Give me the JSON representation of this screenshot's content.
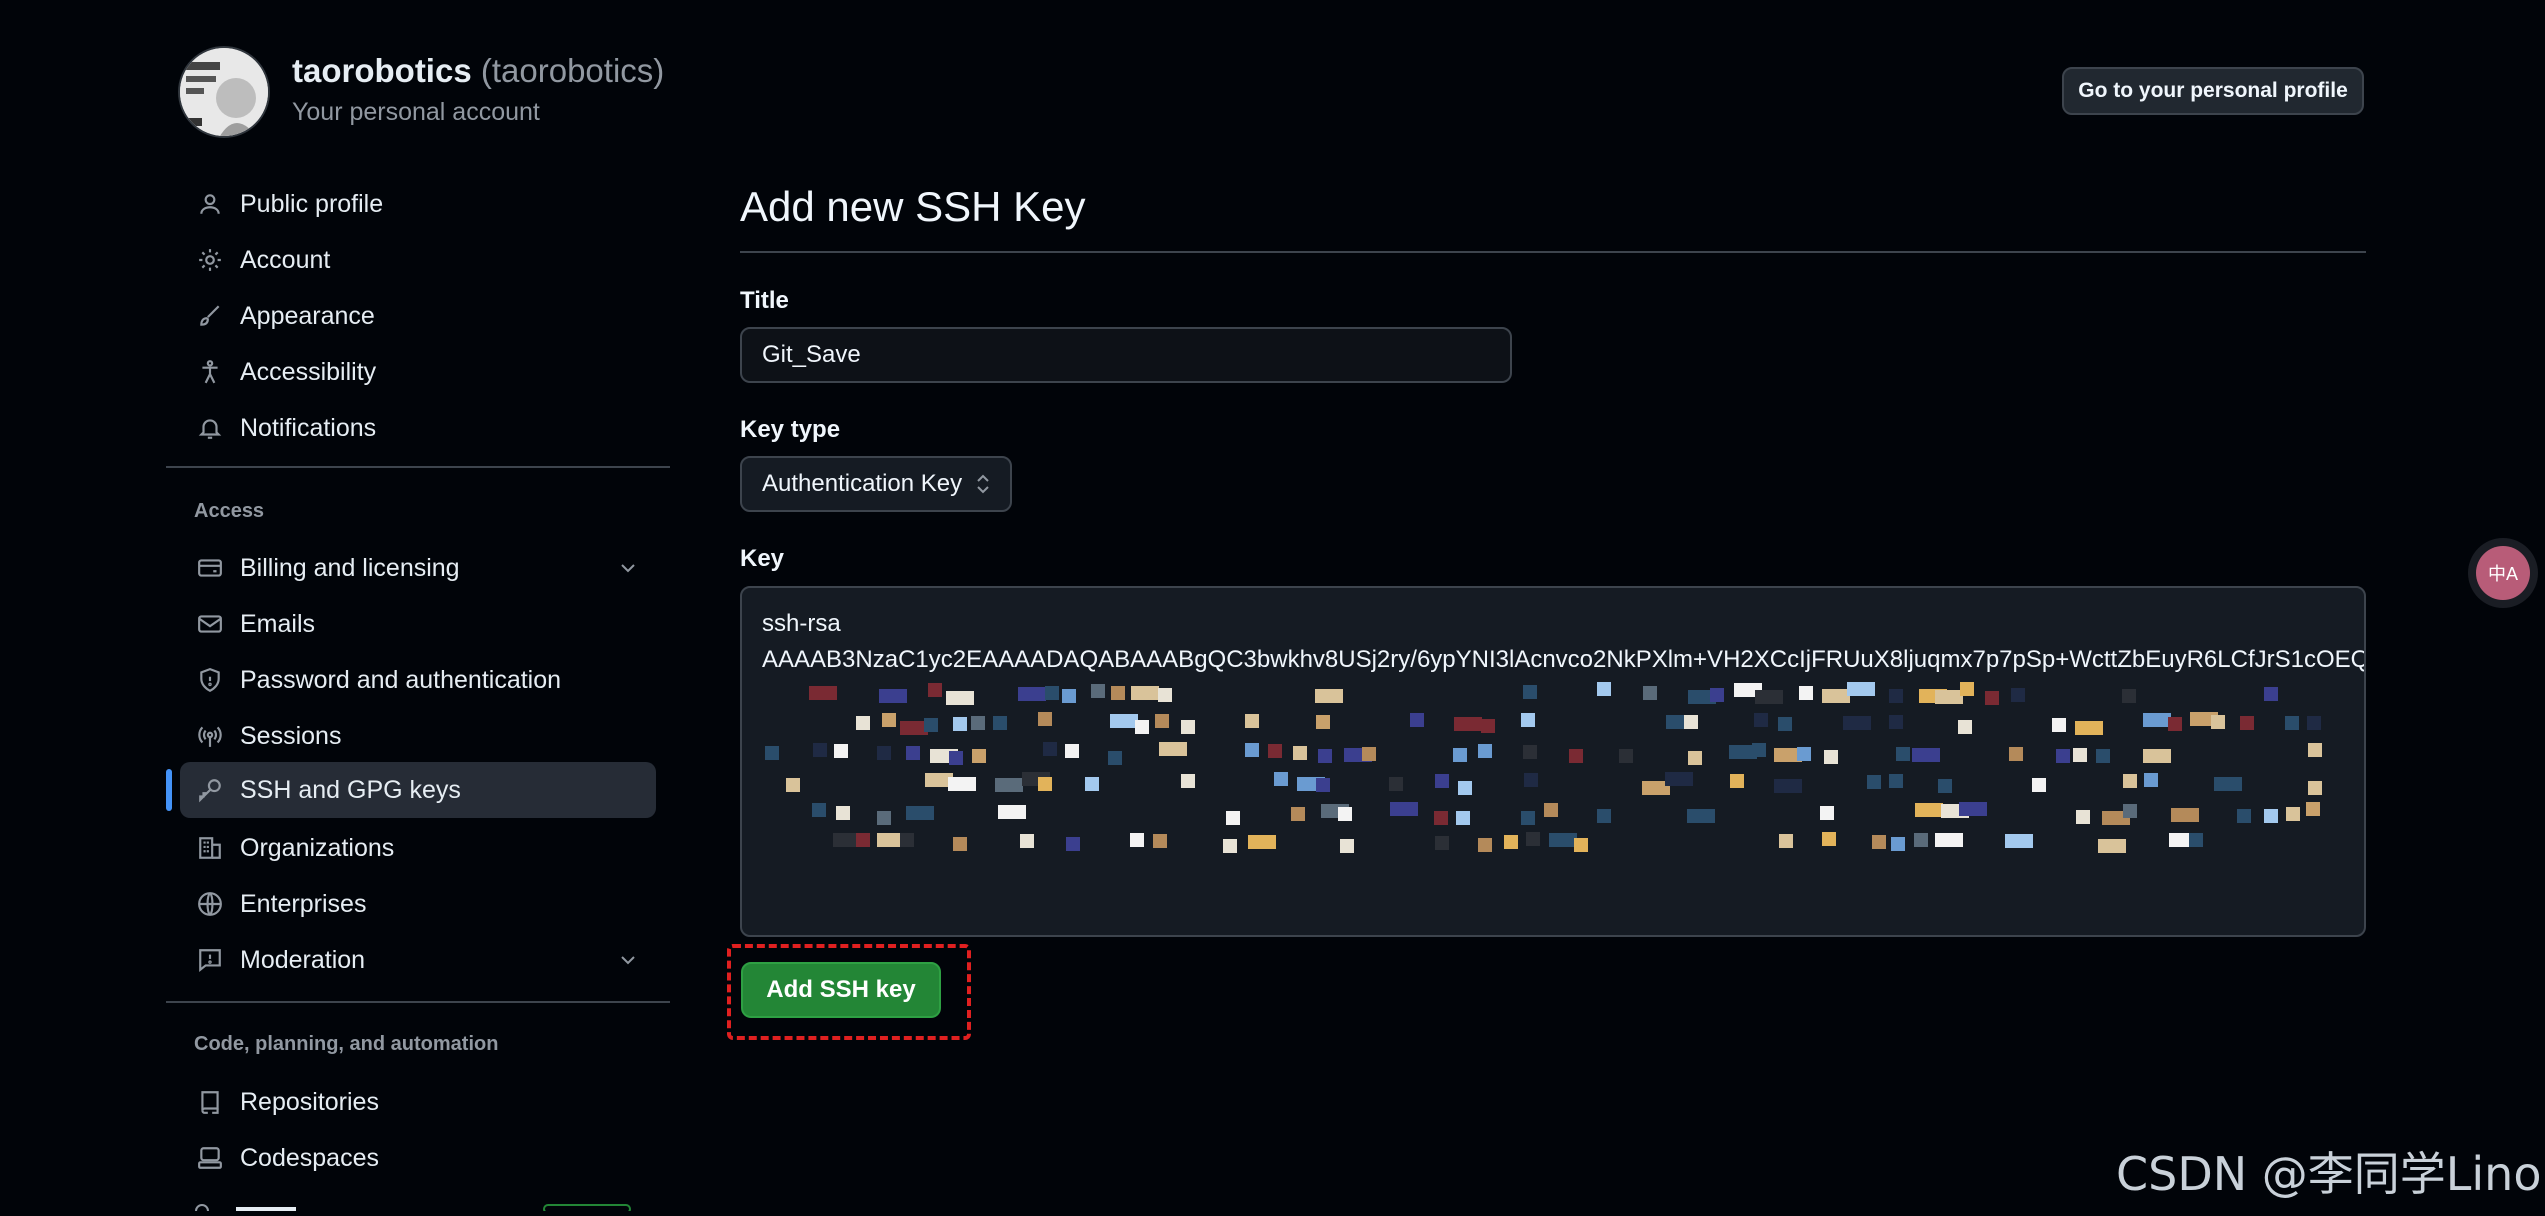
{
  "account": {
    "name": "taorobotics",
    "login": "(taorobotics)",
    "subtitle": "Your personal account"
  },
  "header": {
    "profile_button": "Go to your personal profile"
  },
  "sidebar": {
    "group1": [
      {
        "label": "Public profile",
        "icon": "person-icon"
      },
      {
        "label": "Account",
        "icon": "gear-icon"
      },
      {
        "label": "Appearance",
        "icon": "paintbrush-icon"
      },
      {
        "label": "Accessibility",
        "icon": "accessibility-icon"
      },
      {
        "label": "Notifications",
        "icon": "bell-icon"
      }
    ],
    "access_heading": "Access",
    "group2": [
      {
        "label": "Billing and licensing",
        "icon": "credit-card-icon",
        "expandable": true
      },
      {
        "label": "Emails",
        "icon": "mail-icon"
      },
      {
        "label": "Password and authentication",
        "icon": "shield-icon"
      },
      {
        "label": "Sessions",
        "icon": "broadcast-icon"
      },
      {
        "label": "SSH and GPG keys",
        "icon": "key-icon",
        "active": true
      },
      {
        "label": "Organizations",
        "icon": "organization-icon"
      },
      {
        "label": "Enterprises",
        "icon": "globe-icon"
      },
      {
        "label": "Moderation",
        "icon": "report-icon",
        "expandable": true
      }
    ],
    "code_heading": "Code, planning, and automation",
    "group3": [
      {
        "label": "Repositories",
        "icon": "repo-icon"
      },
      {
        "label": "Codespaces",
        "icon": "codespaces-icon"
      }
    ]
  },
  "form": {
    "heading": "Add new SSH Key",
    "title_label": "Title",
    "title_value": "Git_Save",
    "keytype_label": "Key type",
    "keytype_value": "Authentication Key",
    "key_label": "Key",
    "key_line1": "ssh-rsa",
    "key_line2": "AAAAB3NzaC1yc2EAAAADAQABAAABgQC3bwkhv8USj2ry/6ypYNI3lAcnvco2NkPXlm+VH2XCcIjFRUuX8ljuqmx7p7pSp+WcttZbEuyR6LCfJrS1cOEQ",
    "submit_label": "Add SSH key"
  },
  "overlay": {
    "translate_glyph": "中A",
    "watermark": "CSDN @李同学Lino"
  },
  "colors": {
    "background": "#010409",
    "accent_active": "#4493f8",
    "primary_button": "#238636",
    "highlight_box": "#e02020"
  }
}
